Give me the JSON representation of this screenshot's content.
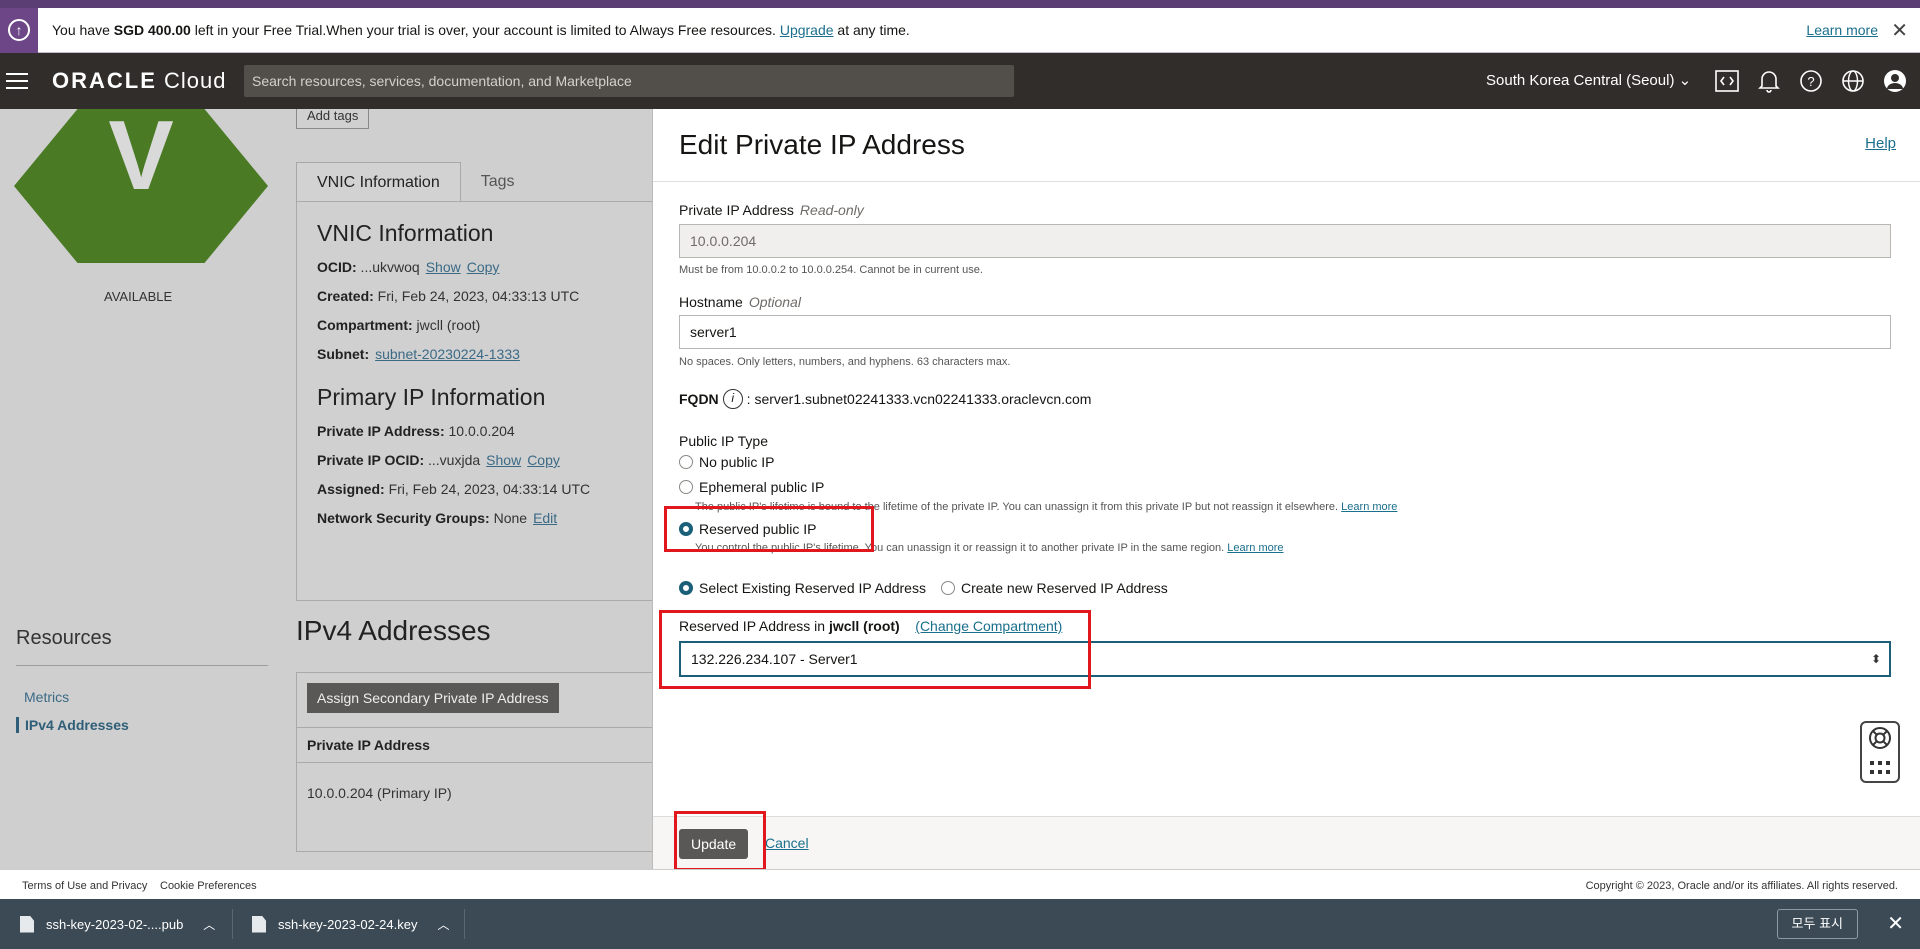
{
  "trial_banner": {
    "text_prefix": "You have ",
    "amount": "SGD 400.00",
    "text_middle": " left in your Free Trial.When your trial is over, your account is limited to Always Free resources. ",
    "upgrade": "Upgrade",
    "text_suffix": " at any time.",
    "learn_more": "Learn more",
    "close": "✕"
  },
  "header": {
    "logo_brand": "ORACLE",
    "logo_product": " Cloud",
    "search_placeholder": "Search resources, services, documentation, and Marketplace",
    "region": "South Korea Central (Seoul)"
  },
  "background": {
    "instance_letter": "V",
    "status": "AVAILABLE",
    "add_tags": "Add tags",
    "tabs": [
      "VNIC Information",
      "Tags"
    ],
    "vnic_heading": "VNIC Information",
    "ocid_label": "OCID:",
    "ocid_value": " ...ukvwoq",
    "show": "Show",
    "copy": "Copy",
    "created_label": "Created:",
    "created_value": " Fri, Feb 24, 2023, 04:33:13 UTC",
    "compartment_label": "Compartment:",
    "compartment_value": " jwcll (root)",
    "subnet_label": "Subnet:",
    "subnet_value": "subnet-20230224-1333",
    "primary_heading": "Primary IP Information",
    "pip_label": "Private IP Address:",
    "pip_value": " 10.0.0.204",
    "pocid_label": "Private IP OCID:",
    "pocid_value": " ...vuxjda",
    "assigned_label": "Assigned:",
    "assigned_value": " Fri, Feb 24, 2023, 04:33:14 UTC",
    "nsg_label": "Network Security Groups:",
    "nsg_value": " None",
    "edit": "Edit",
    "resources_title": "Resources",
    "resources": [
      "Metrics",
      "IPv4 Addresses"
    ],
    "ipv4_title": "IPv4 Addresses",
    "assign_button": "Assign Secondary Private IP Address",
    "table_header": "Private IP Address",
    "table_row": "10.0.0.204 (Primary IP)"
  },
  "drawer": {
    "title": "Edit Private IP Address",
    "help": "Help",
    "private_ip_label": "Private IP Address",
    "private_ip_tag": "Read-only",
    "private_ip_value": "10.0.0.204",
    "private_ip_hint": "Must be from 10.0.0.2 to 10.0.0.254. Cannot be in current use.",
    "hostname_label": "Hostname",
    "hostname_tag": "Optional",
    "hostname_value": "server1",
    "hostname_hint": "No spaces. Only letters, numbers, and hyphens. 63 characters max.",
    "fqdn_label": "FQDN",
    "fqdn_value": ": server1.subnet02241333.vcn02241333.oraclevcn.com",
    "public_ip_type_label": "Public IP Type",
    "opt_none": "No public IP",
    "opt_ephemeral": "Ephemeral public IP",
    "ephemeral_note": "The public IP's lifetime is bound to the lifetime of the private IP. You can unassign it from this private IP but not reassign it elsewhere. ",
    "opt_reserved": "Reserved public IP",
    "reserved_note": "You control the public IP's lifetime. You can unassign it or reassign it to another private IP in the same region. ",
    "learn_more": "Learn more",
    "opt_select_existing": "Select Existing Reserved IP Address",
    "opt_create_new": "Create new Reserved IP Address",
    "reserved_in_label": "Reserved IP Address in ",
    "reserved_compartment": "jwcll (root)",
    "change_compartment": "(Change Compartment)",
    "reserved_selected": "132.226.234.107 - Server1",
    "update": "Update",
    "cancel": "Cancel"
  },
  "footer": {
    "terms": "Terms of Use and Privacy",
    "cookies": "Cookie Preferences",
    "copyright": "Copyright © 2023, Oracle and/or its affiliates. All rights reserved."
  },
  "downloads": {
    "file1": "ssh-key-2023-02-....pub",
    "file2": "ssh-key-2023-02-24.key",
    "show_all": "모두 표시",
    "close": "✕"
  },
  "colors": {
    "header_bg": "#312d2a",
    "trial_purple": "#6d4687",
    "accent_teal": "#1b5f79",
    "highlight_red": "#e0181e",
    "instance_green": "#4a7a24"
  }
}
